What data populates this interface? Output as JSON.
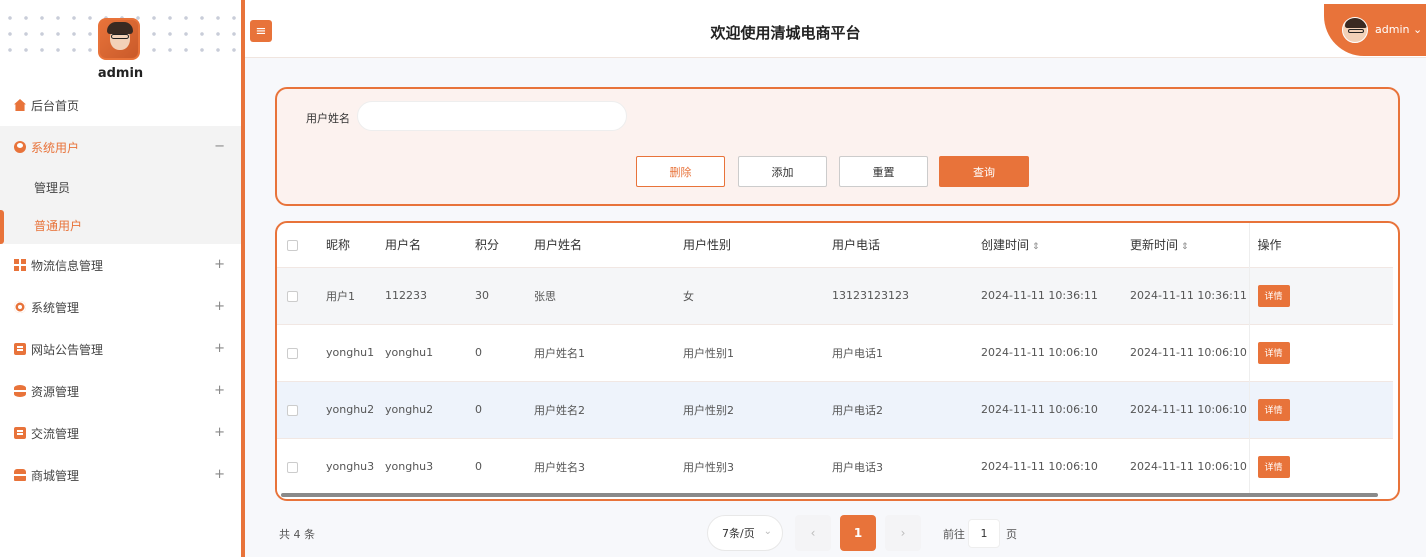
{
  "sidebar": {
    "username": "admin",
    "menu": [
      {
        "label": "后台首页",
        "icon": "home-icon"
      },
      {
        "label": "系统用户",
        "icon": "user-icon",
        "expanded_symbol": "−",
        "children": [
          {
            "label": "管理员"
          },
          {
            "label": "普通用户",
            "active": true
          }
        ]
      },
      {
        "label": "物流信息管理",
        "icon": "grid-icon",
        "toggle": "+"
      },
      {
        "label": "系统管理",
        "icon": "gear-icon",
        "toggle": "+"
      },
      {
        "label": "网站公告管理",
        "icon": "document-icon",
        "toggle": "+"
      },
      {
        "label": "资源管理",
        "icon": "database-icon",
        "toggle": "+"
      },
      {
        "label": "交流管理",
        "icon": "chat-icon",
        "toggle": "+"
      },
      {
        "label": "商城管理",
        "icon": "shop-icon",
        "toggle": "+"
      }
    ]
  },
  "header": {
    "menu_toggle_icon": "≡",
    "title": "欢迎使用清城电商平台",
    "user": "admin",
    "user_dropdown_icon": "⌄"
  },
  "search": {
    "label": "用户姓名",
    "value": "",
    "buttons": {
      "delete": "删除",
      "add": "添加",
      "reset": "重置",
      "query": "查询"
    }
  },
  "table": {
    "headers": {
      "nickname": "昵称",
      "username": "用户名",
      "points": "积分",
      "realname": "用户姓名",
      "gender": "用户性别",
      "phone": "用户电话",
      "created": "创建时间",
      "updated": "更新时间",
      "op": "操作"
    },
    "sort_icon": "⇕",
    "detail_label": "详情",
    "rows": [
      {
        "nickname": "用户1",
        "username": "112233",
        "points": "30",
        "realname": "张思",
        "gender": "女",
        "phone": "13123123123",
        "created": "2024-11-11 10:36:11",
        "updated": "2024-11-11 10:36:11"
      },
      {
        "nickname": "yonghu1",
        "username": "yonghu1",
        "points": "0",
        "realname": "用户姓名1",
        "gender": "用户性别1",
        "phone": "用户电话1",
        "created": "2024-11-11 10:06:10",
        "updated": "2024-11-11 10:06:10"
      },
      {
        "nickname": "yonghu2",
        "username": "yonghu2",
        "points": "0",
        "realname": "用户姓名2",
        "gender": "用户性别2",
        "phone": "用户电话2",
        "created": "2024-11-11 10:06:10",
        "updated": "2024-11-11 10:06:10"
      },
      {
        "nickname": "yonghu3",
        "username": "yonghu3",
        "points": "0",
        "realname": "用户姓名3",
        "gender": "用户性别3",
        "phone": "用户电话3",
        "created": "2024-11-11 10:06:10",
        "updated": "2024-11-11 10:06:10"
      }
    ]
  },
  "pagination": {
    "total": "共 4 条",
    "page_size": "7条/页",
    "prev": "‹",
    "current": "1",
    "next": "›",
    "goto_prefix": "前往",
    "goto_value": "1",
    "goto_suffix": "页"
  },
  "colors": {
    "accent": "#e8733a",
    "panel_bg": "#fcf2ef",
    "content_bg": "#f7f8fb"
  }
}
